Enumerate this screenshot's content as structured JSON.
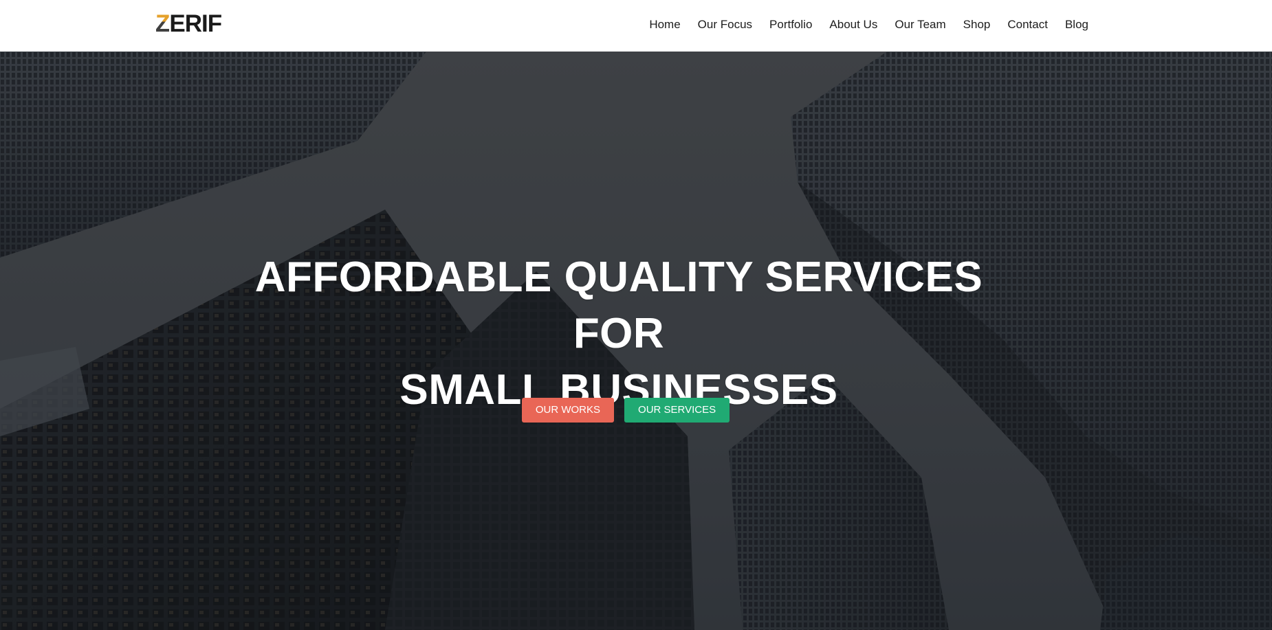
{
  "header": {
    "logo": {
      "first_letter": "Z",
      "rest": "ERIF"
    },
    "nav": [
      {
        "label": "Home"
      },
      {
        "label": "Our Focus"
      },
      {
        "label": "Portfolio"
      },
      {
        "label": "About Us"
      },
      {
        "label": "Our Team"
      },
      {
        "label": "Shop"
      },
      {
        "label": "Contact"
      },
      {
        "label": "Blog"
      }
    ]
  },
  "hero": {
    "title_line1": "AFFORDABLE QUALITY SERVICES FOR",
    "title_line2": "SMALL BUSINESSES",
    "buttons": {
      "works_label": "OUR WORKS",
      "services_label": "OUR SERVICES"
    }
  },
  "colors": {
    "works_button": "#e96656",
    "services_button": "#20aa73",
    "logo_accent": "#e5a12b",
    "nav_text": "#1c1c1c",
    "hero_text": "#ffffff"
  }
}
